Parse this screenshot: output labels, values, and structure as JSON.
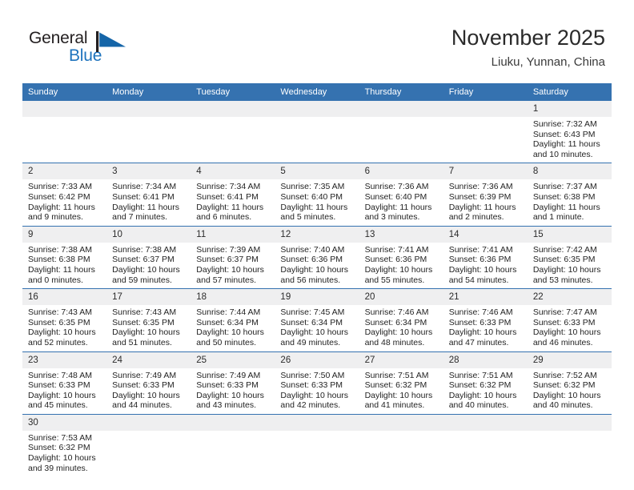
{
  "brand": {
    "name_part1": "General",
    "name_part2": "Blue",
    "flag_icon": "blue-triangle-flag",
    "color_dark": "#231f20",
    "color_blue": "#1e73bd"
  },
  "header": {
    "title": "November 2025",
    "subtitle": "Liuku, Yunnan, China"
  },
  "theme": {
    "header_bg": "#3572b0",
    "header_text": "#ffffff",
    "daynum_bg": "#efeff0",
    "row_divider": "#3572b0"
  },
  "weekdays": [
    "Sunday",
    "Monday",
    "Tuesday",
    "Wednesday",
    "Thursday",
    "Friday",
    "Saturday"
  ],
  "labels": {
    "sunrise_prefix": "Sunrise: ",
    "sunset_prefix": "Sunset: ",
    "daylight_prefix": "Daylight: "
  },
  "weeks": [
    [
      {
        "day": "",
        "empty": true
      },
      {
        "day": "",
        "empty": true
      },
      {
        "day": "",
        "empty": true
      },
      {
        "day": "",
        "empty": true
      },
      {
        "day": "",
        "empty": true
      },
      {
        "day": "",
        "empty": true
      },
      {
        "day": "1",
        "sunrise": "Sunrise: 7:32 AM",
        "sunset": "Sunset: 6:43 PM",
        "daylight_l1": "Daylight: 11 hours",
        "daylight_l2": "and 10 minutes."
      }
    ],
    [
      {
        "day": "2",
        "sunrise": "Sunrise: 7:33 AM",
        "sunset": "Sunset: 6:42 PM",
        "daylight_l1": "Daylight: 11 hours",
        "daylight_l2": "and 9 minutes."
      },
      {
        "day": "3",
        "sunrise": "Sunrise: 7:34 AM",
        "sunset": "Sunset: 6:41 PM",
        "daylight_l1": "Daylight: 11 hours",
        "daylight_l2": "and 7 minutes."
      },
      {
        "day": "4",
        "sunrise": "Sunrise: 7:34 AM",
        "sunset": "Sunset: 6:41 PM",
        "daylight_l1": "Daylight: 11 hours",
        "daylight_l2": "and 6 minutes."
      },
      {
        "day": "5",
        "sunrise": "Sunrise: 7:35 AM",
        "sunset": "Sunset: 6:40 PM",
        "daylight_l1": "Daylight: 11 hours",
        "daylight_l2": "and 5 minutes."
      },
      {
        "day": "6",
        "sunrise": "Sunrise: 7:36 AM",
        "sunset": "Sunset: 6:40 PM",
        "daylight_l1": "Daylight: 11 hours",
        "daylight_l2": "and 3 minutes."
      },
      {
        "day": "7",
        "sunrise": "Sunrise: 7:36 AM",
        "sunset": "Sunset: 6:39 PM",
        "daylight_l1": "Daylight: 11 hours",
        "daylight_l2": "and 2 minutes."
      },
      {
        "day": "8",
        "sunrise": "Sunrise: 7:37 AM",
        "sunset": "Sunset: 6:38 PM",
        "daylight_l1": "Daylight: 11 hours",
        "daylight_l2": "and 1 minute."
      }
    ],
    [
      {
        "day": "9",
        "sunrise": "Sunrise: 7:38 AM",
        "sunset": "Sunset: 6:38 PM",
        "daylight_l1": "Daylight: 11 hours",
        "daylight_l2": "and 0 minutes."
      },
      {
        "day": "10",
        "sunrise": "Sunrise: 7:38 AM",
        "sunset": "Sunset: 6:37 PM",
        "daylight_l1": "Daylight: 10 hours",
        "daylight_l2": "and 59 minutes."
      },
      {
        "day": "11",
        "sunrise": "Sunrise: 7:39 AM",
        "sunset": "Sunset: 6:37 PM",
        "daylight_l1": "Daylight: 10 hours",
        "daylight_l2": "and 57 minutes."
      },
      {
        "day": "12",
        "sunrise": "Sunrise: 7:40 AM",
        "sunset": "Sunset: 6:36 PM",
        "daylight_l1": "Daylight: 10 hours",
        "daylight_l2": "and 56 minutes."
      },
      {
        "day": "13",
        "sunrise": "Sunrise: 7:41 AM",
        "sunset": "Sunset: 6:36 PM",
        "daylight_l1": "Daylight: 10 hours",
        "daylight_l2": "and 55 minutes."
      },
      {
        "day": "14",
        "sunrise": "Sunrise: 7:41 AM",
        "sunset": "Sunset: 6:36 PM",
        "daylight_l1": "Daylight: 10 hours",
        "daylight_l2": "and 54 minutes."
      },
      {
        "day": "15",
        "sunrise": "Sunrise: 7:42 AM",
        "sunset": "Sunset: 6:35 PM",
        "daylight_l1": "Daylight: 10 hours",
        "daylight_l2": "and 53 minutes."
      }
    ],
    [
      {
        "day": "16",
        "sunrise": "Sunrise: 7:43 AM",
        "sunset": "Sunset: 6:35 PM",
        "daylight_l1": "Daylight: 10 hours",
        "daylight_l2": "and 52 minutes."
      },
      {
        "day": "17",
        "sunrise": "Sunrise: 7:43 AM",
        "sunset": "Sunset: 6:35 PM",
        "daylight_l1": "Daylight: 10 hours",
        "daylight_l2": "and 51 minutes."
      },
      {
        "day": "18",
        "sunrise": "Sunrise: 7:44 AM",
        "sunset": "Sunset: 6:34 PM",
        "daylight_l1": "Daylight: 10 hours",
        "daylight_l2": "and 50 minutes."
      },
      {
        "day": "19",
        "sunrise": "Sunrise: 7:45 AM",
        "sunset": "Sunset: 6:34 PM",
        "daylight_l1": "Daylight: 10 hours",
        "daylight_l2": "and 49 minutes."
      },
      {
        "day": "20",
        "sunrise": "Sunrise: 7:46 AM",
        "sunset": "Sunset: 6:34 PM",
        "daylight_l1": "Daylight: 10 hours",
        "daylight_l2": "and 48 minutes."
      },
      {
        "day": "21",
        "sunrise": "Sunrise: 7:46 AM",
        "sunset": "Sunset: 6:33 PM",
        "daylight_l1": "Daylight: 10 hours",
        "daylight_l2": "and 47 minutes."
      },
      {
        "day": "22",
        "sunrise": "Sunrise: 7:47 AM",
        "sunset": "Sunset: 6:33 PM",
        "daylight_l1": "Daylight: 10 hours",
        "daylight_l2": "and 46 minutes."
      }
    ],
    [
      {
        "day": "23",
        "sunrise": "Sunrise: 7:48 AM",
        "sunset": "Sunset: 6:33 PM",
        "daylight_l1": "Daylight: 10 hours",
        "daylight_l2": "and 45 minutes."
      },
      {
        "day": "24",
        "sunrise": "Sunrise: 7:49 AM",
        "sunset": "Sunset: 6:33 PM",
        "daylight_l1": "Daylight: 10 hours",
        "daylight_l2": "and 44 minutes."
      },
      {
        "day": "25",
        "sunrise": "Sunrise: 7:49 AM",
        "sunset": "Sunset: 6:33 PM",
        "daylight_l1": "Daylight: 10 hours",
        "daylight_l2": "and 43 minutes."
      },
      {
        "day": "26",
        "sunrise": "Sunrise: 7:50 AM",
        "sunset": "Sunset: 6:33 PM",
        "daylight_l1": "Daylight: 10 hours",
        "daylight_l2": "and 42 minutes."
      },
      {
        "day": "27",
        "sunrise": "Sunrise: 7:51 AM",
        "sunset": "Sunset: 6:32 PM",
        "daylight_l1": "Daylight: 10 hours",
        "daylight_l2": "and 41 minutes."
      },
      {
        "day": "28",
        "sunrise": "Sunrise: 7:51 AM",
        "sunset": "Sunset: 6:32 PM",
        "daylight_l1": "Daylight: 10 hours",
        "daylight_l2": "and 40 minutes."
      },
      {
        "day": "29",
        "sunrise": "Sunrise: 7:52 AM",
        "sunset": "Sunset: 6:32 PM",
        "daylight_l1": "Daylight: 10 hours",
        "daylight_l2": "and 40 minutes."
      }
    ],
    [
      {
        "day": "30",
        "sunrise": "Sunrise: 7:53 AM",
        "sunset": "Sunset: 6:32 PM",
        "daylight_l1": "Daylight: 10 hours",
        "daylight_l2": "and 39 minutes."
      },
      {
        "day": "",
        "empty": true
      },
      {
        "day": "",
        "empty": true
      },
      {
        "day": "",
        "empty": true
      },
      {
        "day": "",
        "empty": true
      },
      {
        "day": "",
        "empty": true
      },
      {
        "day": "",
        "empty": true
      }
    ]
  ]
}
